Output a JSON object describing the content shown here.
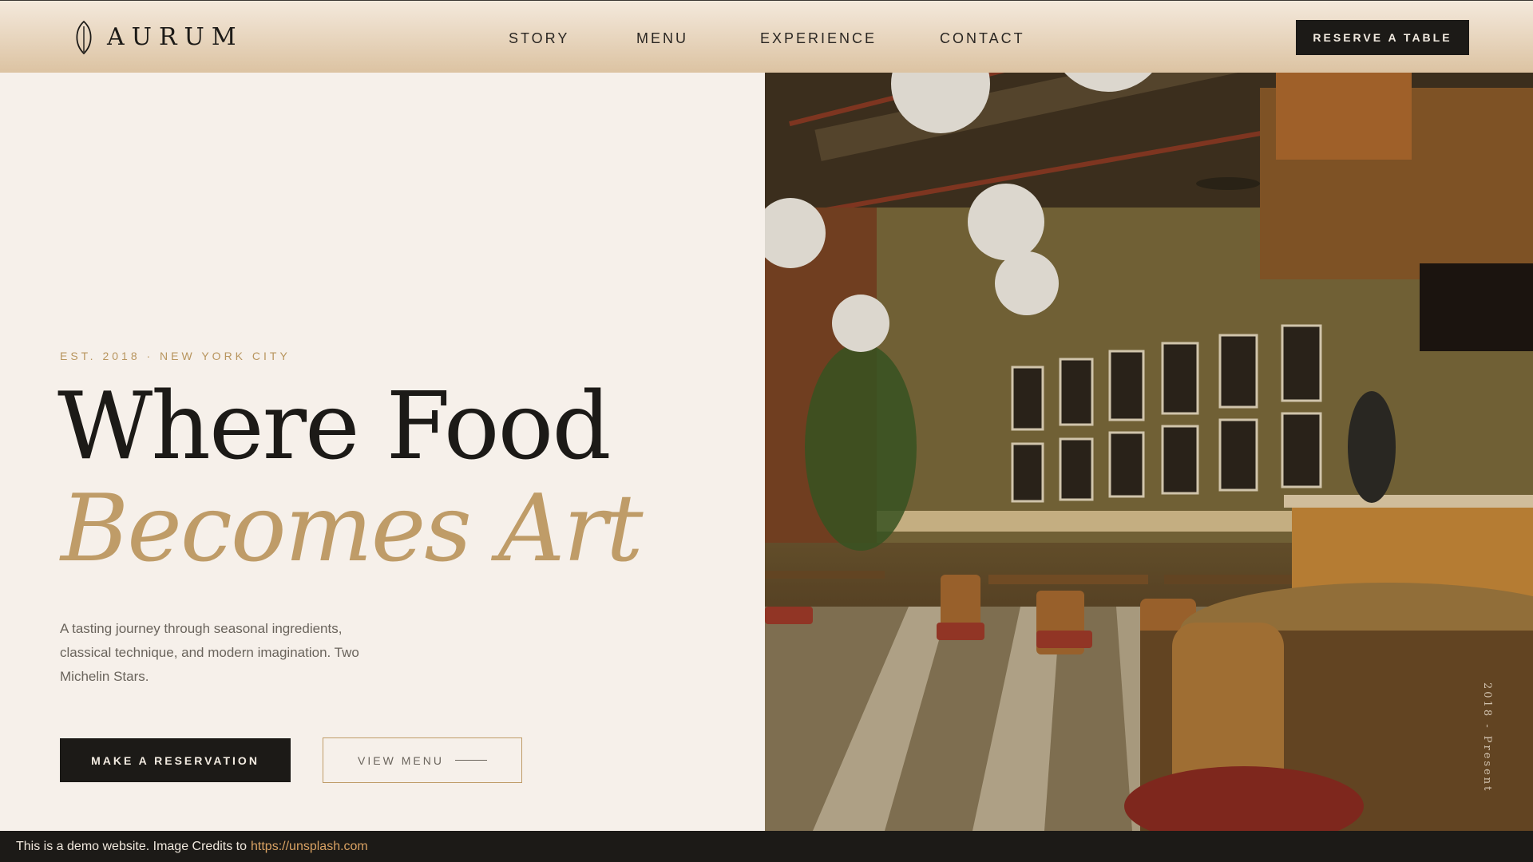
{
  "header": {
    "logo_text": "AURUM",
    "nav": [
      "STORY",
      "MENU",
      "EXPERIENCE",
      "CONTACT"
    ],
    "reserve_label": "RESERVE A TABLE"
  },
  "hero": {
    "eyebrow": "EST. 2018 · NEW YORK CITY",
    "headline": "Where Food",
    "headline_accent": "Becomes Art",
    "lead": "A tasting journey through seasonal ingredients, classical technique, and modern imagination. Two Michelin Stars.",
    "primary_cta": "MAKE A RESERVATION",
    "secondary_cta": "VIEW MENU",
    "vertical_caption": "2018 - Present"
  },
  "footer_bar": {
    "text": "This is a demo website. Image Credits to",
    "link": "https://unsplash.com"
  },
  "colors": {
    "accent": "#bf9c68",
    "dark": "#1c1a17",
    "background": "#f6f0ea",
    "link": "#d9a263"
  }
}
